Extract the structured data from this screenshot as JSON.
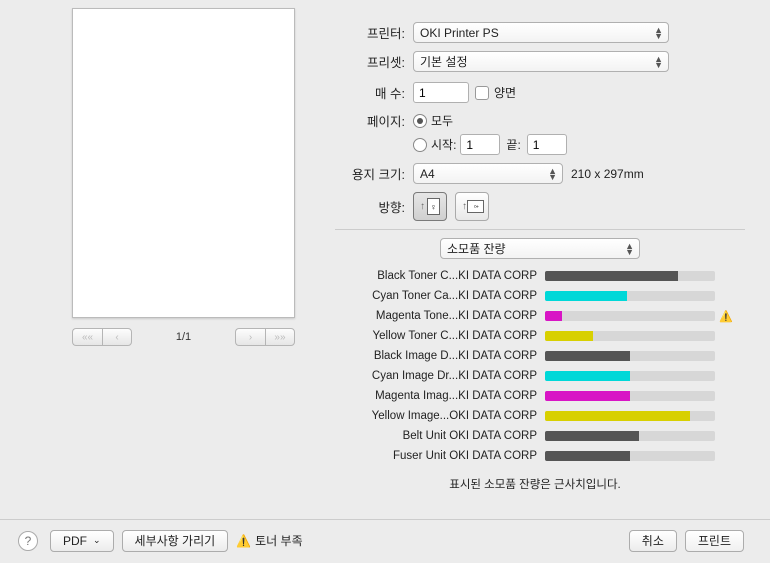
{
  "labels": {
    "printer": "프린터:",
    "preset": "프리셋:",
    "copies": "매 수:",
    "twosided": "양면",
    "pages": "페이지:",
    "all": "모두",
    "from": "시작:",
    "to": "끝:",
    "paper": "용지 크기:",
    "orient": "방향:"
  },
  "printer": {
    "selected": "OKI Printer PS"
  },
  "preset": {
    "selected": "기본 설정"
  },
  "copies": {
    "value": "1"
  },
  "pages": {
    "from": "1",
    "to": "1"
  },
  "paper": {
    "selected": "A4",
    "dims": "210 x 297mm"
  },
  "section": {
    "selected": "소모품 잔량"
  },
  "preview": {
    "page_info": "1/1"
  },
  "supplies": {
    "items": [
      {
        "label": "Black Toner C...KI DATA CORP",
        "color": "#555555",
        "pct": 78,
        "warn": false
      },
      {
        "label": "Cyan Toner Ca...KI DATA CORP",
        "color": "#00d8d8",
        "pct": 48,
        "warn": false
      },
      {
        "label": "Magenta Tone...KI DATA CORP",
        "color": "#d815c5",
        "pct": 10,
        "warn": true
      },
      {
        "label": "Yellow Toner C...KI DATA CORP",
        "color": "#d8d000",
        "pct": 28,
        "warn": false
      },
      {
        "label": "Black Image D...KI DATA CORP",
        "color": "#555555",
        "pct": 50,
        "warn": false
      },
      {
        "label": "Cyan Image Dr...KI DATA CORP",
        "color": "#00d8d8",
        "pct": 50,
        "warn": false
      },
      {
        "label": "Magenta Imag...KI DATA CORP",
        "color": "#d815c5",
        "pct": 50,
        "warn": false
      },
      {
        "label": "Yellow Image...OKI DATA CORP",
        "color": "#d8d000",
        "pct": 85,
        "warn": false
      },
      {
        "label": "Belt Unit OKI DATA CORP",
        "color": "#555555",
        "pct": 55,
        "warn": false
      },
      {
        "label": "Fuser Unit OKI DATA CORP",
        "color": "#555555",
        "pct": 50,
        "warn": false
      }
    ],
    "note": "표시된 소모품 잔량은 근사치입니다."
  },
  "footer": {
    "pdf": "PDF",
    "hide_details": "세부사항 가리기",
    "low_toner": "토너 부족",
    "cancel": "취소",
    "print": "프린트"
  }
}
